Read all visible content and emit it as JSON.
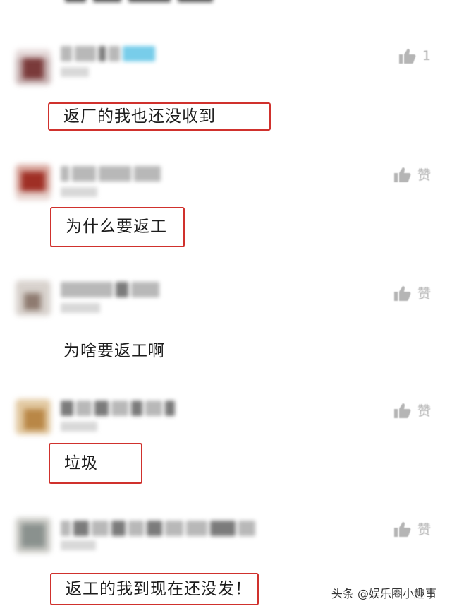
{
  "comments": [
    {
      "text": "返厂的我也还没收到",
      "likes": "1",
      "highlighted": true
    },
    {
      "text": "为什么要返工",
      "likes": "赞",
      "highlighted": true
    },
    {
      "text": "为啥要返工啊",
      "likes": "赞",
      "highlighted": false
    },
    {
      "text": "垃圾",
      "likes": "赞",
      "highlighted": true
    },
    {
      "text": "返工的我到现在还没发！",
      "likes": "赞",
      "highlighted": true
    }
  ],
  "watermark": {
    "text": "头条 @娱乐圈小趣事"
  },
  "colors": {
    "highlight_border": "#d0312d",
    "like_gray": "#b0b0b0"
  },
  "icons": {
    "like": "thumbs-up-icon"
  }
}
